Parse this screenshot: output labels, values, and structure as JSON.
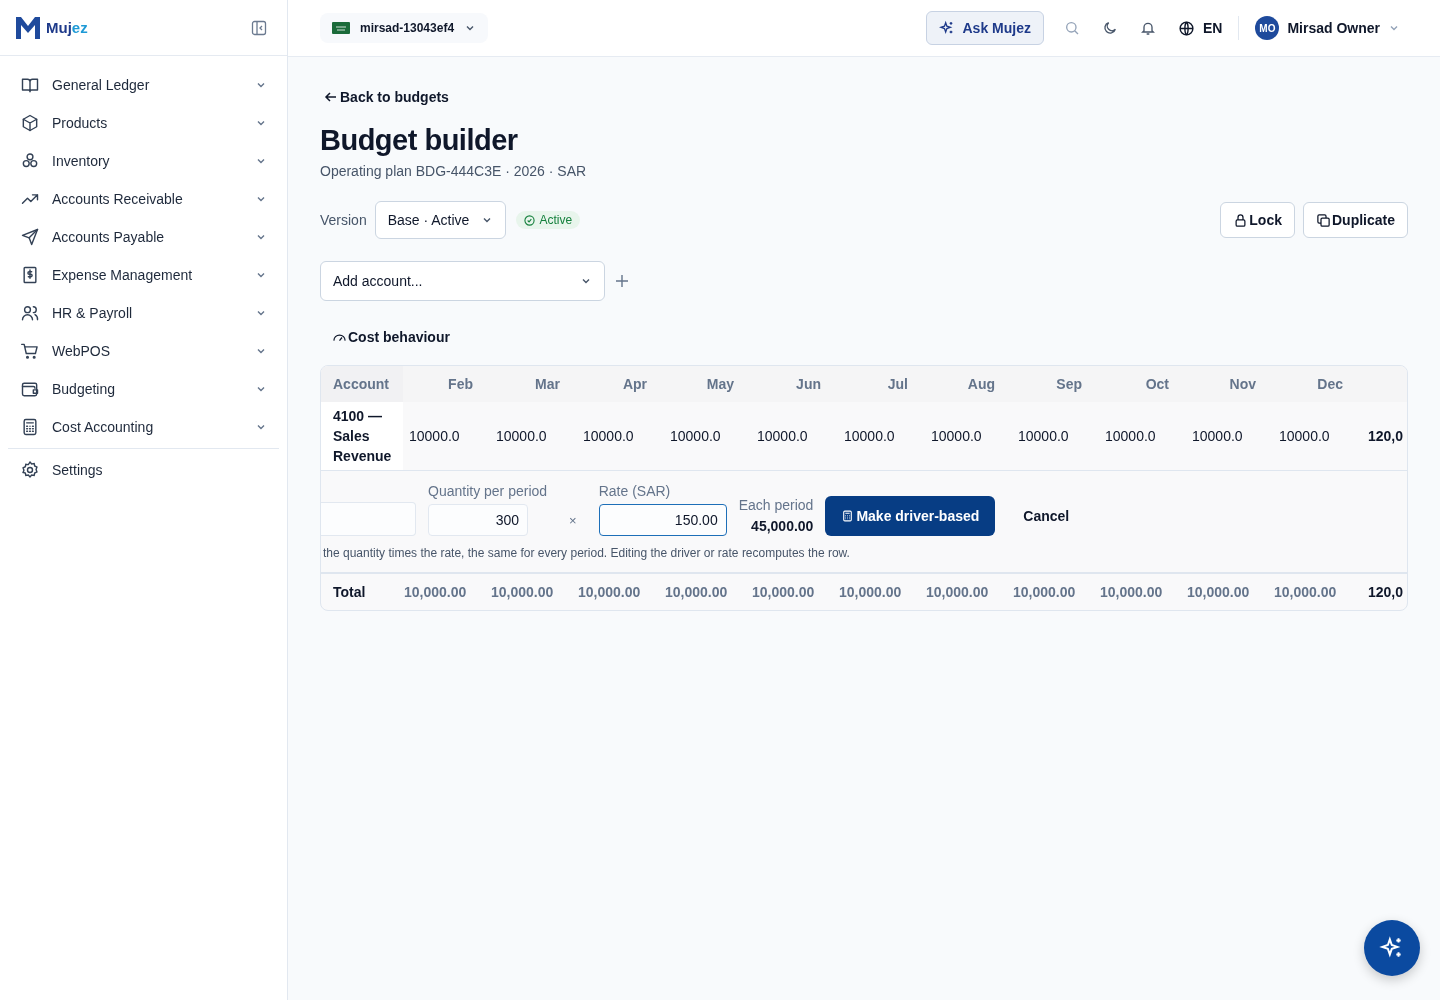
{
  "brand": {
    "name_a": "Muj",
    "name_b": "ez"
  },
  "sidebar": {
    "items": [
      {
        "label": "General Ledger"
      },
      {
        "label": "Products"
      },
      {
        "label": "Inventory"
      },
      {
        "label": "Accounts Receivable"
      },
      {
        "label": "Accounts Payable"
      },
      {
        "label": "Expense Management"
      },
      {
        "label": "HR & Payroll"
      },
      {
        "label": "WebPOS"
      },
      {
        "label": "Budgeting"
      },
      {
        "label": "Cost Accounting"
      }
    ],
    "footer_item": {
      "label": "Settings"
    }
  },
  "topbar": {
    "org": "mirsad-13043ef4",
    "ask": "Ask Mujez",
    "language": "EN",
    "avatar": "MO",
    "user": "Mirsad Owner"
  },
  "page": {
    "back": "Back to budgets",
    "title": "Budget builder",
    "subtitle": "Operating plan BDG-444C3E · 2026 · SAR",
    "version_label": "Version",
    "version": "Base · Active",
    "status": "Active",
    "actions": [
      "Lock",
      "Duplicate"
    ],
    "add_account_placeholder": "Add account...",
    "cost_behaviour": "Cost behaviour"
  },
  "table": {
    "columns": [
      "Account",
      "Feb",
      "Mar",
      "Apr",
      "May",
      "Jun",
      "Jul",
      "Aug",
      "Sep",
      "Oct",
      "Nov",
      "Dec"
    ],
    "rows": [
      {
        "account": "4100 — Sales Revenue",
        "values": [
          "10000.0",
          "10000.0",
          "10000.0",
          "10000.0",
          "10000.0",
          "10000.0",
          "10000.0",
          "10000.0",
          "10000.0",
          "10000.0",
          "10000.0"
        ],
        "total": "120,0"
      }
    ],
    "driver": {
      "quantity_label": "Quantity per period",
      "quantity": "300",
      "operator": "×",
      "rate_label": "Rate (SAR)",
      "rate": "150.00",
      "each_label": "Each period",
      "each_value": "45,000.00",
      "submit": "Make driver-based",
      "cancel": "Cancel",
      "help": "the quantity times the rate, the same for every period. Editing the driver or rate recomputes the row."
    },
    "total_row": {
      "label": "Total",
      "values": [
        "10,000.00",
        "10,000.00",
        "10,000.00",
        "10,000.00",
        "10,000.00",
        "10,000.00",
        "10,000.00",
        "10,000.00",
        "10,000.00",
        "10,000.00",
        "10,000.00"
      ],
      "total": "120,0"
    }
  }
}
